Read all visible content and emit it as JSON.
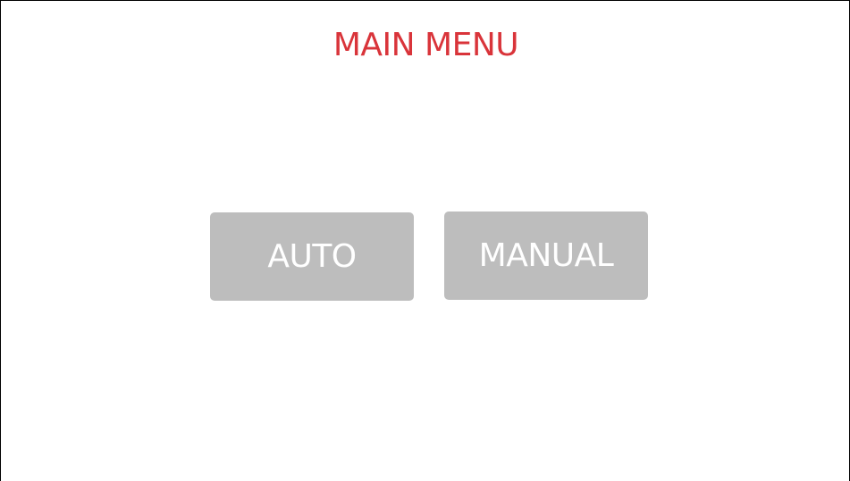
{
  "screen": {
    "title": "MAIN MENU"
  },
  "buttons": {
    "auto_label": "AUTO",
    "manual_label": "MANUAL"
  },
  "colors": {
    "title": "#d9343a",
    "button_bg": "#bdbdbd",
    "button_text": "#ffffff",
    "background": "#ffffff",
    "border": "#000000"
  }
}
